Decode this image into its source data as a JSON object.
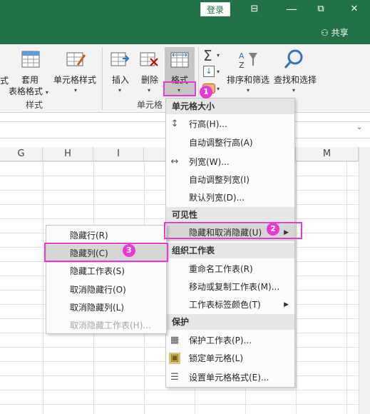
{
  "titlebar": {
    "login": "登录",
    "share": "共享",
    "restore_glyph": "⧉",
    "minimize_glyph": "⊟",
    "close_glyph": "✕"
  },
  "ribbon": {
    "partial_left": "式",
    "table_format": {
      "line1": "套用",
      "line2": "表格格式"
    },
    "cell_styles": "单元格样式",
    "styles_group": "样式",
    "insert": "插入",
    "delete": "删除",
    "format": "格式",
    "cells_group": "单元格",
    "sum_glyph": "Σ",
    "sort_filter": "排序和筛选",
    "find_select": "查找和选择"
  },
  "columns": [
    "G",
    "H",
    "I",
    "",
    "",
    "",
    "M"
  ],
  "format_menu": {
    "cell_size_header": "单元格大小",
    "row_height": "行高(H)...",
    "autofit_row": "自动调整行高(A)",
    "col_width": "列宽(W)...",
    "autofit_col": "自动调整列宽(I)",
    "default_width": "默认列宽(D)...",
    "visibility_header": "可见性",
    "hide_unhide": "隐藏和取消隐藏(U)",
    "organize_header": "组织工作表",
    "rename_sheet": "重命名工作表(R)",
    "move_copy": "移动或复制工作表(M)...",
    "tab_color": "工作表标签颜色(T)",
    "protect_header": "保护",
    "protect_sheet": "保护工作表(P)...",
    "lock_cell": "锁定单元格(L)",
    "format_cells": "设置单元格格式(E)..."
  },
  "hide_menu": {
    "hide_rows": "隐藏行(R)",
    "hide_cols": "隐藏列(C)",
    "hide_sheet": "隐藏工作表(S)",
    "unhide_rows": "取消隐藏行(O)",
    "unhide_cols": "取消隐藏列(L)",
    "unhide_sheet": "取消隐藏工作表(H)..."
  },
  "annotations": {
    "step1": "1",
    "step2": "2",
    "step3": "3"
  },
  "colors": {
    "title_green": "#217346",
    "annotation_magenta": "#e83ad0"
  }
}
